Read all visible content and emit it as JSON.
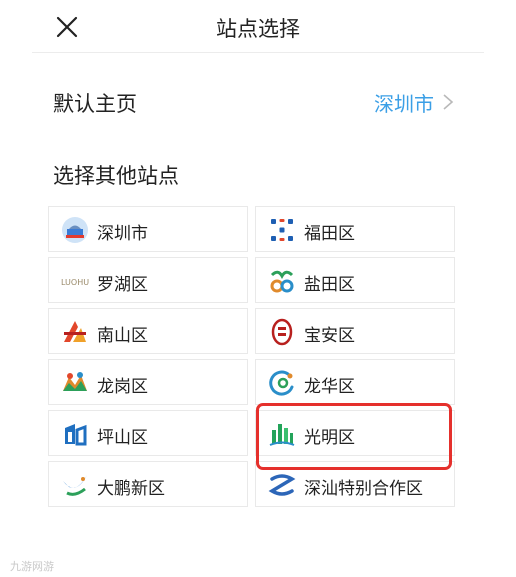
{
  "header": {
    "title": "站点选择"
  },
  "default_home": {
    "label": "默认主页",
    "value": "深圳市"
  },
  "section_title": "选择其他站点",
  "sites": [
    {
      "label": "深圳市",
      "icon": "shenzhen-icon",
      "color": "#3a7bd5"
    },
    {
      "label": "福田区",
      "icon": "futian-icon",
      "color": "#1e5fb3"
    },
    {
      "label": "罗湖区",
      "icon": "luohu-icon",
      "color": "#d9a23a",
      "icon_text": "LUOHU"
    },
    {
      "label": "盐田区",
      "icon": "yantian-icon",
      "color": "#2ca05a"
    },
    {
      "label": "南山区",
      "icon": "nanshan-icon",
      "color": "#e2472b"
    },
    {
      "label": "宝安区",
      "icon": "baoan-icon",
      "color": "#b8201e"
    },
    {
      "label": "龙岗区",
      "icon": "longgang-icon",
      "color": "#e08a2c"
    },
    {
      "label": "龙华区",
      "icon": "longhua-icon",
      "color": "#2a8ec9"
    },
    {
      "label": "坪山区",
      "icon": "pingshan-icon",
      "color": "#1f6fc0"
    },
    {
      "label": "光明区",
      "icon": "guangming-icon",
      "color": "#23a35a"
    },
    {
      "label": "大鹏新区",
      "icon": "dapeng-icon",
      "color": "#2f7fd0"
    },
    {
      "label": "深汕特别合作区",
      "icon": "shenshan-icon",
      "color": "#2c66b8"
    }
  ],
  "highlight_color": "#e5302c",
  "watermark": "九游网游"
}
